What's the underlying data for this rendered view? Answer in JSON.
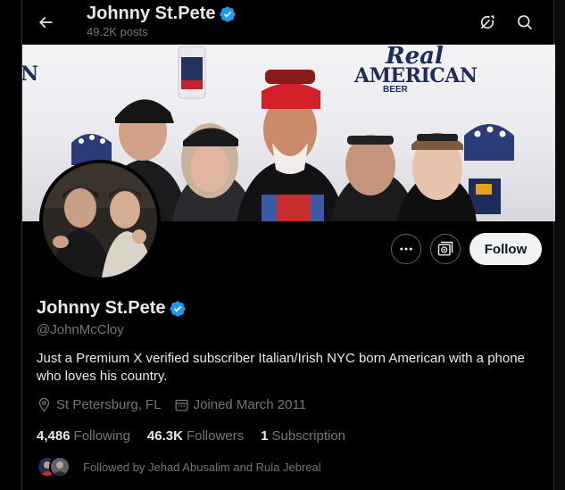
{
  "header": {
    "name": "Johnny St.Pete",
    "posts": "49.2K posts",
    "icons": [
      "back-arrow-icon",
      "grok-icon",
      "search-icon"
    ]
  },
  "banner": {
    "text_real": "Real",
    "text_american": "AMERICAN",
    "text_beer": "BEER",
    "text_edge": "N"
  },
  "profile": {
    "name": "Johnny St.Pete",
    "handle": "@JohnMcCloy",
    "bio": "Just a Premium X verified subscriber Italian/Irish NYC born American with a phone who loves his country.",
    "location": "St Petersburg, FL",
    "joined": "Joined March 2011",
    "verified_color": "#1d9bf0"
  },
  "actions": {
    "follow_label": "Follow",
    "icons": [
      "more-icon",
      "subscribe-icon"
    ]
  },
  "stats": {
    "following_count": "4,486",
    "following_label": "Following",
    "followers_count": "46.3K",
    "followers_label": "Followers",
    "subscriptions_count": "1",
    "subscriptions_label": "Subscription"
  },
  "followed_by": {
    "text": "Followed by Jehad Abusalim and Rula Jebreal"
  },
  "colors": {
    "background": "#000000",
    "primary_text": "#e7e9ea",
    "secondary_text": "#71767b",
    "accent": "#1d9bf0",
    "border": "#2f3336"
  }
}
